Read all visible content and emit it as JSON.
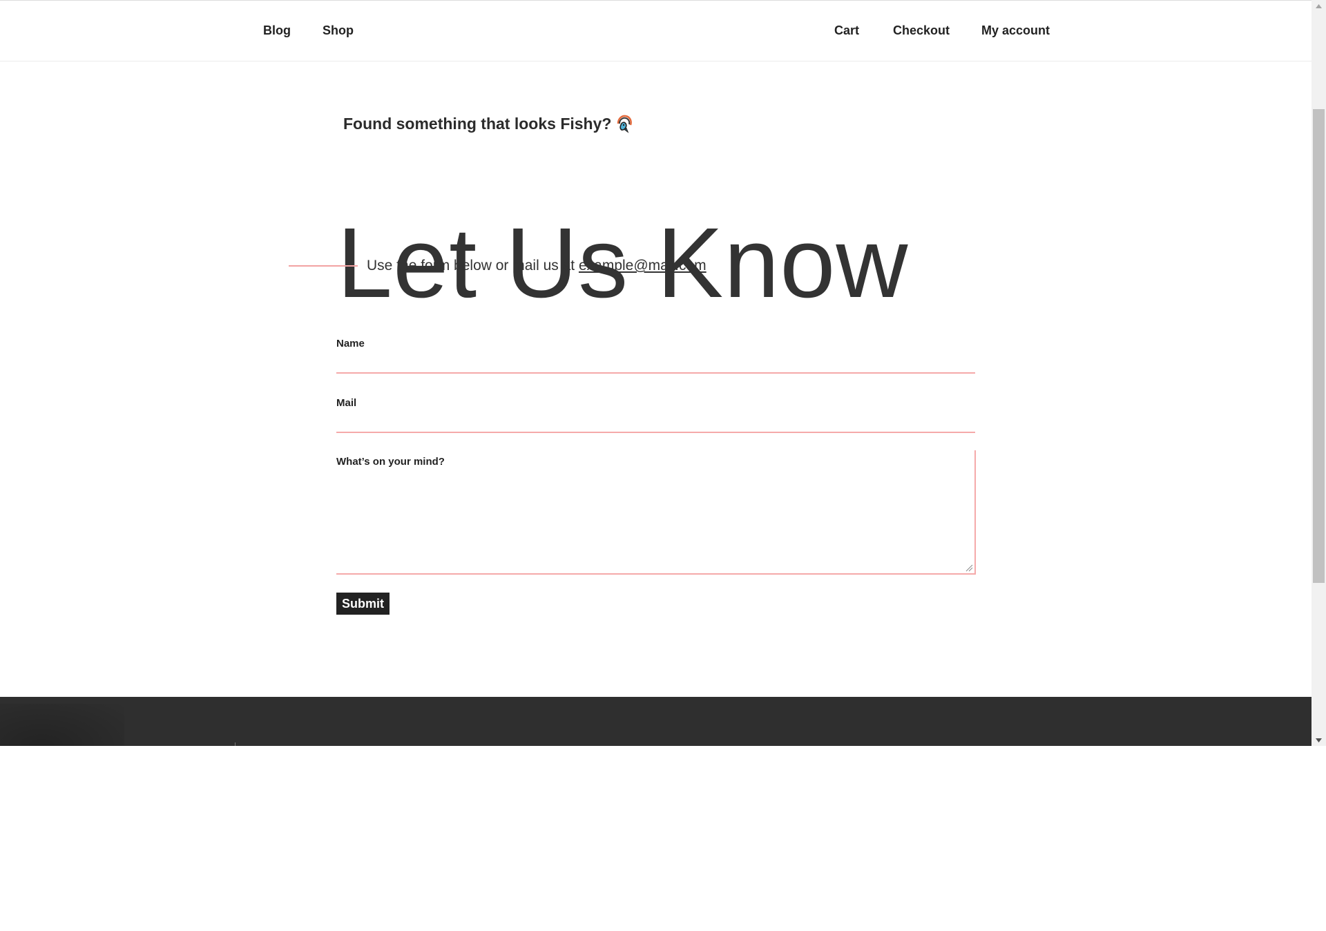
{
  "nav": {
    "left": [
      {
        "label": "Blog"
      },
      {
        "label": "Shop"
      }
    ],
    "right": [
      {
        "label": "Cart"
      },
      {
        "label": "Checkout"
      },
      {
        "label": "My account"
      }
    ]
  },
  "hero": {
    "pre_title": "Found something that looks Fishy?",
    "pre_title_icon": "fish-icon",
    "title": "Let Us Know",
    "subtitle_text": "Use the form below or mail us at",
    "email": "example@mail.com"
  },
  "form": {
    "name_label": "Name",
    "name_value": "",
    "mail_label": "Mail",
    "mail_value": "",
    "message_label": "What’s on your mind?",
    "message_value": "",
    "submit_label": "Submit"
  },
  "colors": {
    "accent": "#f5a9a9",
    "text": "#333333",
    "footer_bg": "#2f2f2f",
    "button_bg": "#222222"
  }
}
